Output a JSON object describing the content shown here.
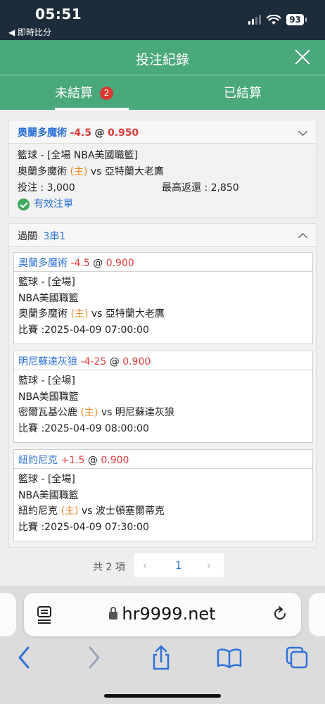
{
  "status": {
    "time": "05:51",
    "back": "◀ 即時比分",
    "battery": "93"
  },
  "header": {
    "title": "投注紀錄"
  },
  "tabs": {
    "unsettled": "未結算",
    "badge": "2",
    "settled": "已結算"
  },
  "bet1": {
    "team": "奧蘭多魔術",
    "handicap": "-4.5",
    "at": "@",
    "odds": "0.950",
    "sport": "籃球 - [全場 NBA美國職籃]",
    "home_team": "奧蘭多魔術",
    "home_tag": "(主)",
    "vs": "vs",
    "away_team": "亞特蘭大老鷹",
    "stake": "投注 : 3,000",
    "max_return": "最高返還 : 2,850",
    "status": "有效注單"
  },
  "parlay": {
    "label": "過關",
    "type": "3串1",
    "legs": [
      {
        "team": "奧蘭多魔術",
        "handicap": "-4.5",
        "at": "@",
        "odds": "0.900",
        "sport": "籃球 - [全場]",
        "league": "NBA美國職籃",
        "home_team": "奧蘭多魔術",
        "home_tag": "(主)",
        "vs": "vs",
        "away_team": "亞特蘭大老鷹",
        "time": "比賽 :2025-04-09 07:00:00"
      },
      {
        "team": "明尼蘇達灰狼",
        "handicap": "-4-25",
        "at": "@",
        "odds": "0.900",
        "sport": "籃球 - [全場]",
        "league": "NBA美國職籃",
        "home_team": "密爾瓦基公鹿",
        "home_tag": "(主)",
        "vs": "vs",
        "away_team": "明尼蘇達灰狼",
        "time": "比賽 :2025-04-09 08:00:00"
      },
      {
        "team": "紐約尼克",
        "handicap": "+1.5",
        "at": "@",
        "odds": "0.900",
        "sport": "籃球 - [全場]",
        "league": "NBA美國職籃",
        "home_team": "紐約尼克",
        "home_tag": "(主)",
        "vs": "vs",
        "away_team": "波士頓塞爾蒂克",
        "time": "比賽 :2025-04-09 07:30:00"
      }
    ]
  },
  "pager": {
    "total": "共 2 項",
    "prev": "‹",
    "page": "1",
    "next": "›"
  },
  "browser": {
    "url": "hr9999.net"
  },
  "colors": {
    "green": "#4aa97b",
    "navy": "#1d2c3b",
    "blue": "#2f72d8",
    "red": "#e03a3a",
    "orange": "#f08a2a"
  }
}
